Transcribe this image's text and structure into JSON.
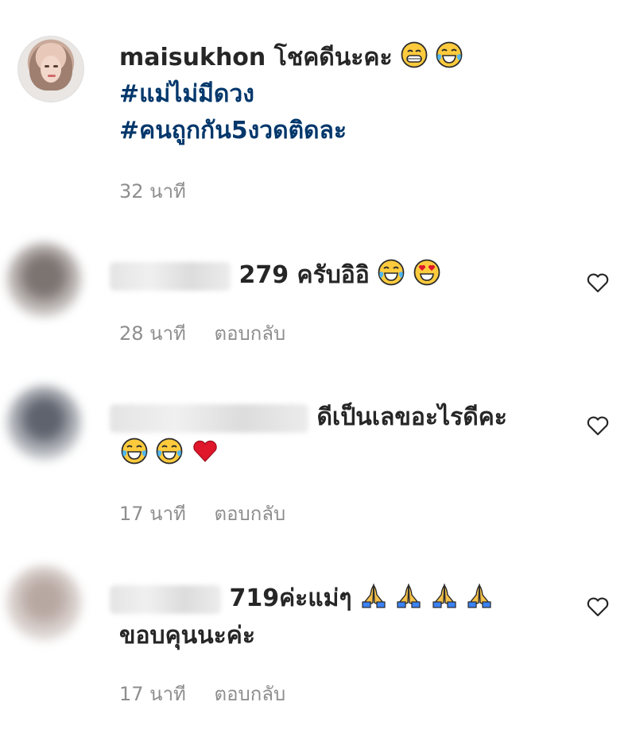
{
  "owner": {
    "username": "maisukhon",
    "text": "โชคดีนะคะ",
    "hashtags": [
      "#แม่ไม่มีดวง",
      "#คนถูกกัน5งวดติดละ"
    ],
    "time": "32 นาที"
  },
  "replies": [
    {
      "text": "279 ครับอิอิ",
      "time": "28 นาที",
      "reply_label": "ตอบกลับ"
    },
    {
      "text": "ดีเป็นเลขอะไรดีคะ",
      "time": "17 นาที",
      "reply_label": "ตอบกลับ"
    },
    {
      "text": "719ค่ะแม่ๆ",
      "text2": "ขอบคุนนะค่ะ",
      "time": "17 นาที",
      "reply_label": "ตอบกลับ"
    }
  ],
  "icons": [
    "grinning-face-emoji",
    "tears-of-joy-emoji",
    "heart-eyes-emoji",
    "red-heart-emoji",
    "folded-hands-emoji",
    "heart-outline-icon"
  ],
  "colors": {
    "hashtag": "#00376b",
    "meta": "#8e8e8e",
    "heart_emoji": "#e0162b"
  }
}
